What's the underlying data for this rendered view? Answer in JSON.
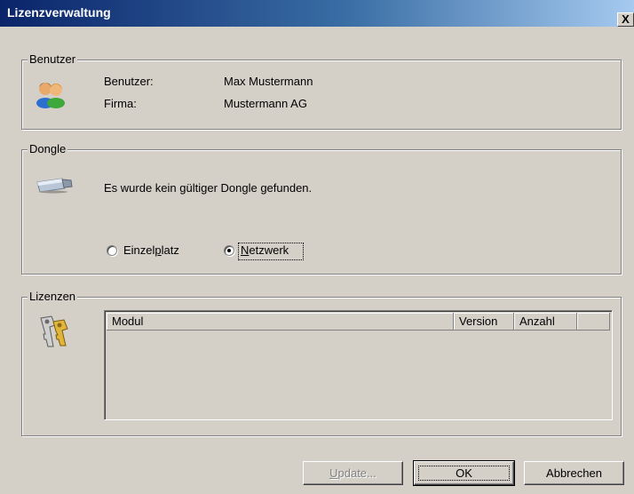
{
  "window": {
    "title": "Lizenzverwaltung",
    "close_label": "X"
  },
  "benutzer": {
    "caption": "Benutzer",
    "icon": "users-icon",
    "user_label": "Benutzer:",
    "user_value": "Max Mustermann",
    "company_label": "Firma:",
    "company_value": "Mustermann AG"
  },
  "dongle": {
    "caption": "Dongle",
    "icon": "usb-dongle-icon",
    "status": "Es wurde kein gültiger Dongle gefunden.",
    "options": [
      {
        "pre": "Einzel",
        "acc": "p",
        "post": "latz",
        "checked": false
      },
      {
        "pre": "",
        "acc": "N",
        "post": "etzwerk",
        "checked": true
      }
    ]
  },
  "lizenzen": {
    "caption": "Lizenzen",
    "icon": "keys-icon",
    "columns": [
      "Modul",
      "Version",
      "Anzahl"
    ],
    "rows": []
  },
  "buttons": {
    "update": {
      "acc": "U",
      "post": "pdate...",
      "enabled": false
    },
    "ok": "OK",
    "cancel": "Abbrechen"
  }
}
